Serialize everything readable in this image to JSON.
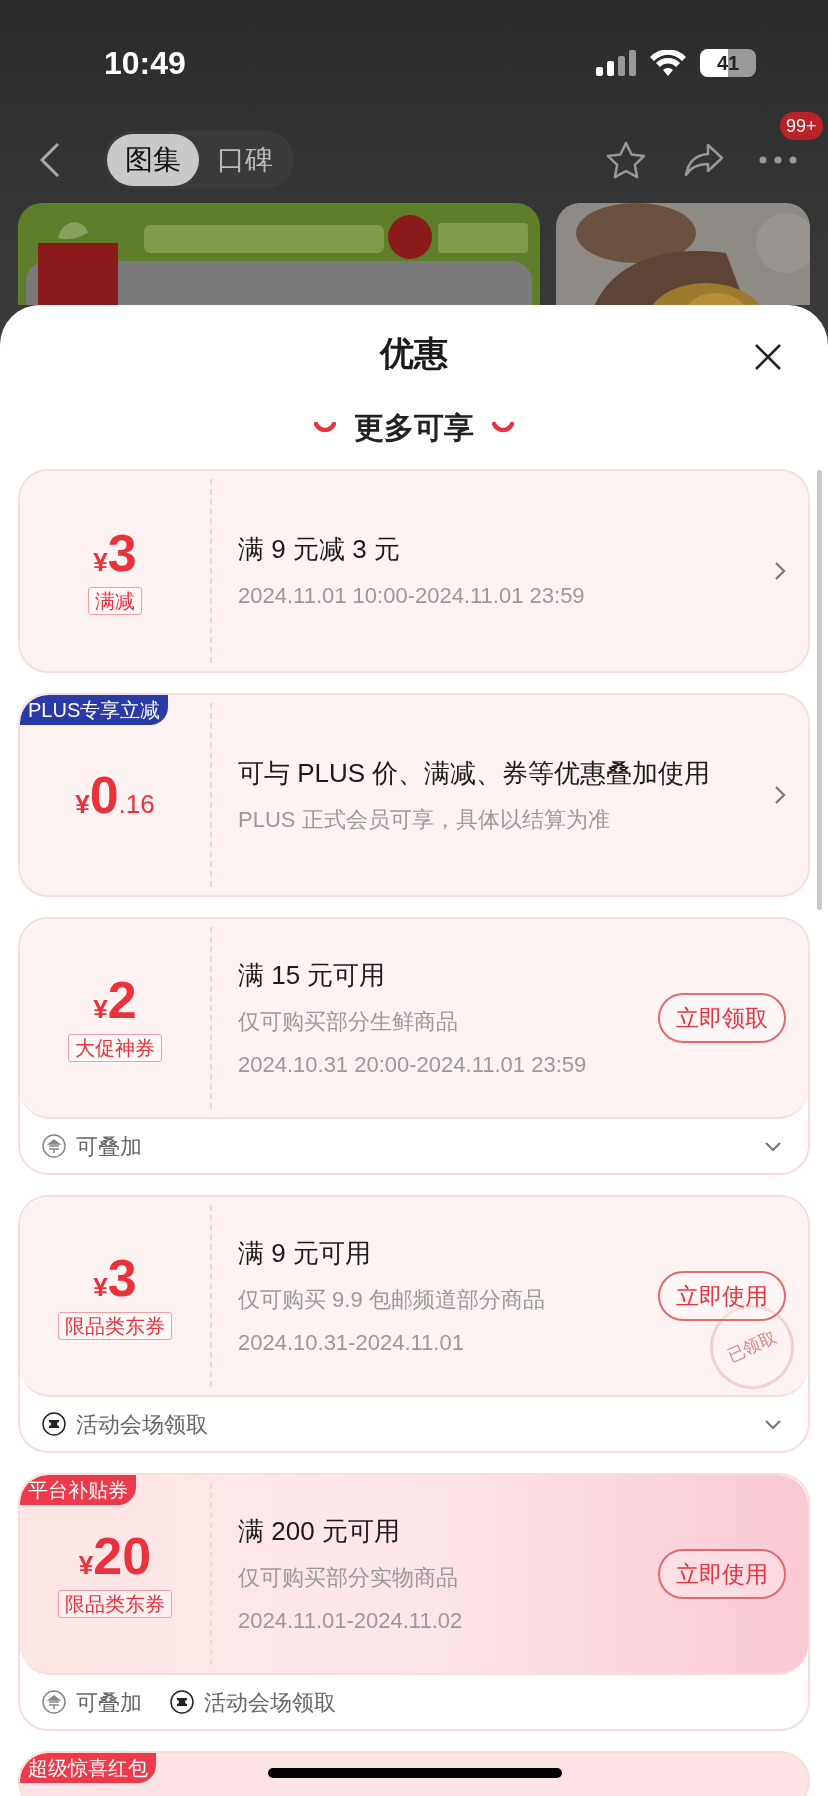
{
  "status_bar": {
    "time": "10:49",
    "battery": "41"
  },
  "nav": {
    "tabs": [
      {
        "label": "图集",
        "selected": true
      },
      {
        "label": "口碑",
        "selected": false
      }
    ],
    "more_badge": "99+"
  },
  "sheet": {
    "title": "优惠",
    "section": "更多可享",
    "coupons": [
      {
        "kind": "standard",
        "currency": "¥",
        "amount": "3",
        "tag": "满减",
        "title": "满 9 元减 3 元",
        "lines": [
          "2024.11.01 10:00-2024.11.01 23:59"
        ],
        "action": {
          "kind": "chevron"
        }
      },
      {
        "kind": "standard",
        "badge": {
          "text": "PLUS专享立减",
          "color": "#2a3aa6"
        },
        "currency": "¥",
        "amount": "0",
        "decimal": ".16",
        "title": "可与 PLUS 价、满减、券等优惠叠加使用",
        "lines": [
          "PLUS 正式会员可享，具体以结算为准"
        ],
        "action": {
          "kind": "chevron"
        }
      },
      {
        "kind": "standard",
        "currency": "¥",
        "amount": "2",
        "tag": "大促神券",
        "title": "满 15 元可用",
        "lines": [
          "仅可购买部分生鲜商品",
          "2024.10.31 20:00-2024.11.01 23:59"
        ],
        "action": {
          "kind": "button",
          "label": "立即领取"
        },
        "footer": [
          {
            "kind": "stack",
            "label": "可叠加"
          }
        ],
        "expandable": true
      },
      {
        "kind": "standard",
        "currency": "¥",
        "amount": "3",
        "tag": "限品类东券",
        "title": "满 9 元可用",
        "lines": [
          "仅可购买 9.9 包邮频道部分商品",
          "2024.10.31-2024.11.01"
        ],
        "action": {
          "kind": "button",
          "label": "立即使用"
        },
        "stamp": "已领取",
        "footer": [
          {
            "kind": "venue",
            "label": "活动会场领取"
          }
        ],
        "expandable": true
      },
      {
        "kind": "featured",
        "badge": {
          "text": "平台补贴券",
          "color": "#ec3a4a"
        },
        "currency": "¥",
        "amount": "20",
        "tag": "限品类东券",
        "title": "满 200 元可用",
        "lines": [
          "仅可购买部分实物商品",
          "2024.11.01-2024.11.02"
        ],
        "action": {
          "kind": "button",
          "label": "立即使用"
        },
        "footer": [
          {
            "kind": "stack",
            "label": "可叠加"
          },
          {
            "kind": "venue",
            "label": "活动会场领取"
          }
        ]
      },
      {
        "kind": "featured",
        "badge": {
          "text": "超级惊喜红包",
          "color": "#ec3a4a"
        }
      }
    ]
  }
}
